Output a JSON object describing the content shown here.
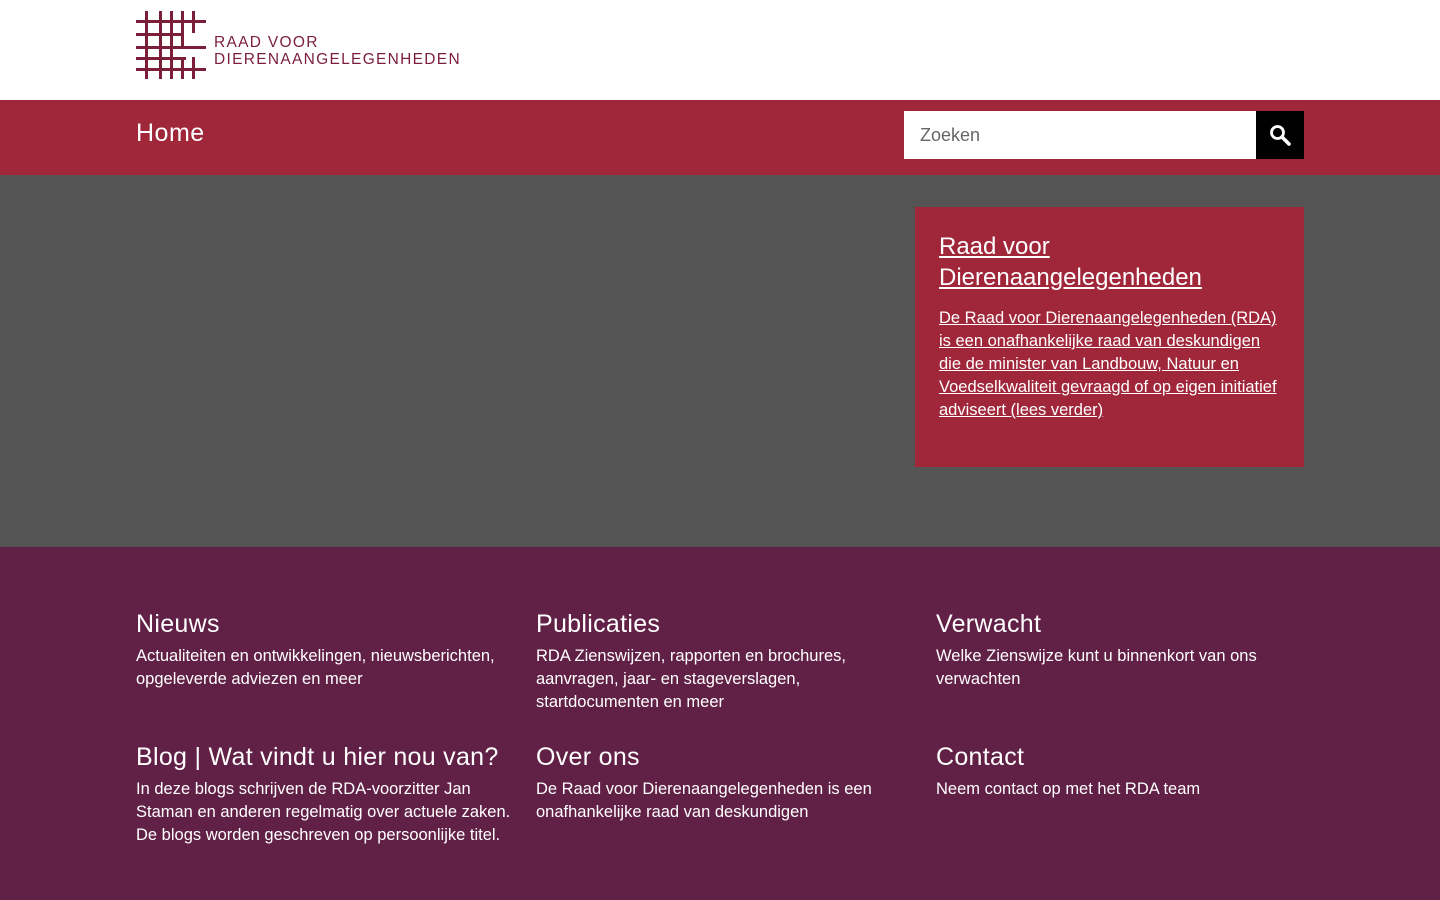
{
  "header": {
    "logo": {
      "line1": "RAAD VOOR",
      "line2": "DIERENAANGELEGENHEDEN",
      "color": "#7b1e3a"
    }
  },
  "nav": {
    "home_label": "Home",
    "background": "#a0263a"
  },
  "search": {
    "placeholder": "Zoeken",
    "value": "",
    "button_icon": "search-icon"
  },
  "hero": {
    "background": "#545454",
    "card": {
      "title": "Raad voor Dierenaangelegenheden",
      "text": "De Raad voor Dierenaangelegenheden (RDA) is een onafhankelijke raad van deskundigen die de minister van Landbouw, Natuur en Voedselkwaliteit gevraagd of op eigen initiatief adviseert (lees verder)"
    }
  },
  "footer": {
    "background": "#612045",
    "sections": [
      {
        "title": "Nieuws",
        "text": "Actualiteiten en ontwikkelingen, nieuwsberichten, opgeleverde adviezen en meer"
      },
      {
        "title": "Publicaties",
        "text": "RDA Zienswijzen, rapporten en brochures, aanvragen, jaar- en stageverslagen, startdocumenten en meer"
      },
      {
        "title": "Verwacht",
        "text": "Welke Zienswijze kunt u binnenkort van ons verwachten"
      },
      {
        "title": "Blog | Wat vindt u hier nou van?",
        "text": "In deze blogs schrijven de RDA-voorzitter Jan Staman en anderen regelmatig over actuele zaken. De blogs worden geschreven op persoonlijke titel."
      },
      {
        "title": "Over ons",
        "text": "De Raad voor Dierenaangelegenheden is een onafhankelijke raad van deskundigen"
      },
      {
        "title": "Contact",
        "text": "Neem contact op met het RDA team"
      }
    ]
  }
}
